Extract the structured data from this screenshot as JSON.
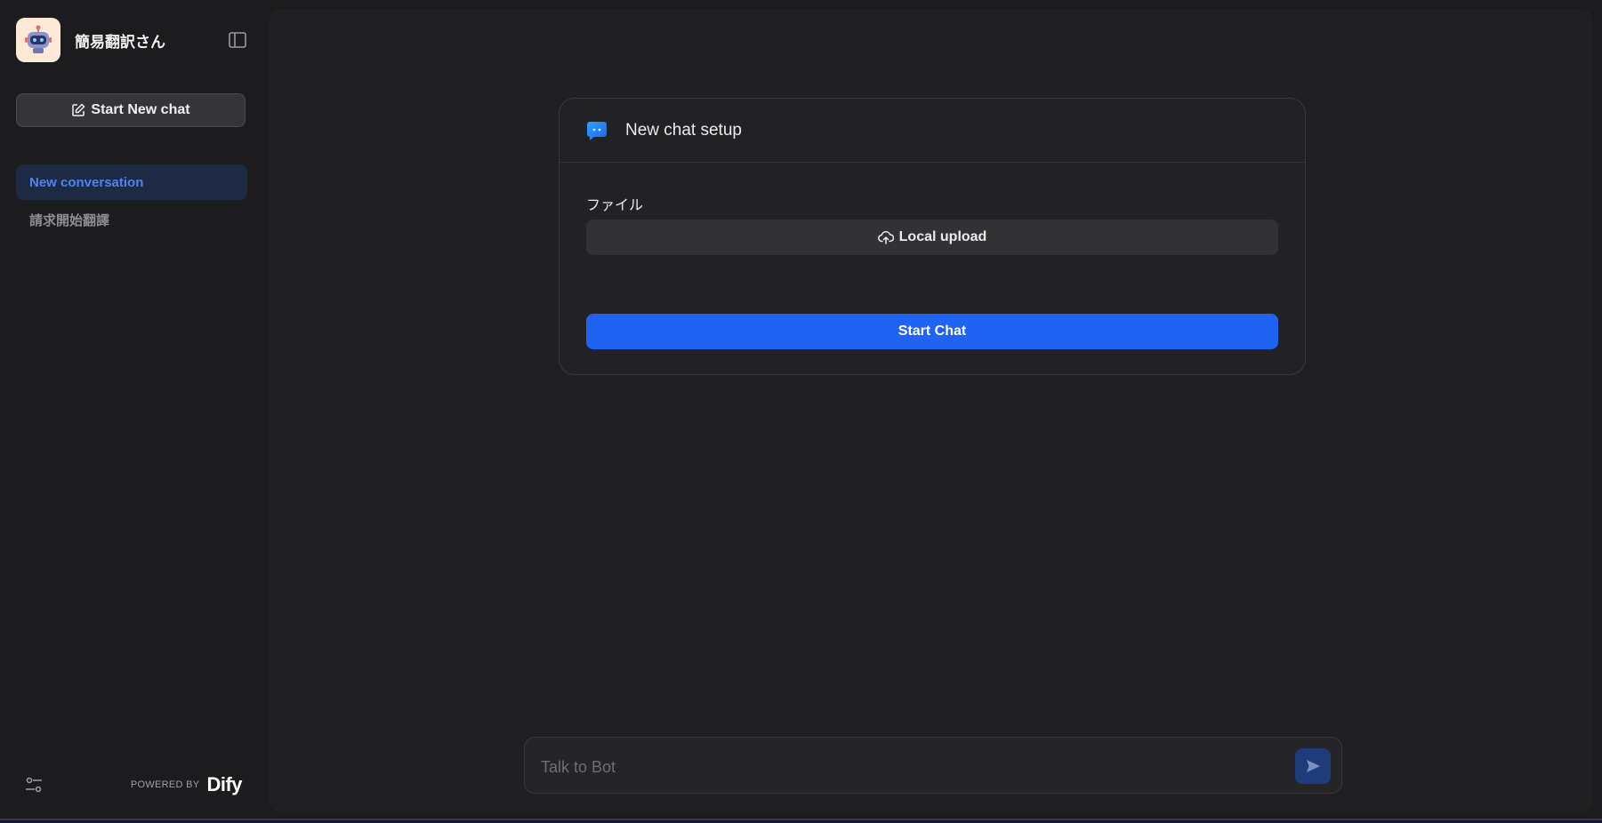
{
  "app": {
    "title": "簡易翻訳さん",
    "logo_icon": "robot-icon"
  },
  "sidebar": {
    "new_chat_label": "Start New chat",
    "conversations": [
      {
        "label": "New conversation",
        "active": true
      },
      {
        "label": "請求開始翻譯",
        "active": false
      }
    ],
    "powered_by_label": "POWERED BY",
    "brand": "Dify"
  },
  "setup": {
    "title": "New chat setup",
    "field_label": "ファイル",
    "upload_label": "Local upload",
    "start_label": "Start Chat"
  },
  "chat_input": {
    "placeholder": "Talk to Bot",
    "value": ""
  },
  "colors": {
    "accent": "#1f63f2",
    "active_item_text": "#4d84f5",
    "active_item_bg": "#1e2a44",
    "background": "#1c1c1e",
    "main_panel": "#202022"
  }
}
